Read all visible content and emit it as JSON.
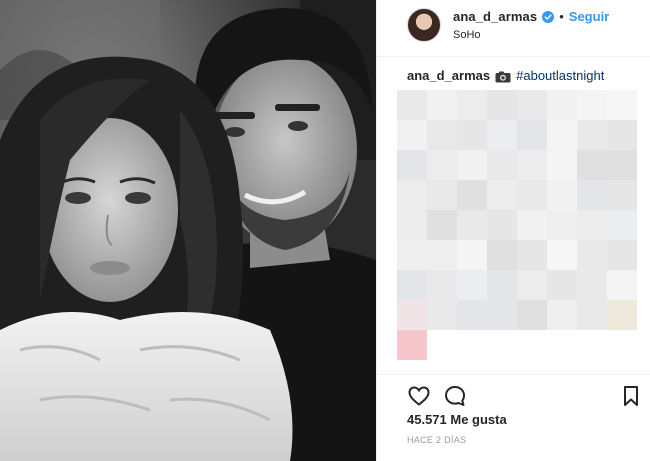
{
  "post": {
    "username": "ana_d_armas",
    "verified": true,
    "follow_label": "Seguir",
    "separator": "•",
    "location": "SoHo",
    "caption": {
      "user": "ana_d_armas",
      "emoji": "camera-icon",
      "hashtag": "#aboutlastnight"
    },
    "likes": "45.571 Me gusta",
    "time": "HACE 2 DÍAS"
  },
  "colors": {
    "link": "#3897f0",
    "hashtag": "#003569",
    "border": "#efefef",
    "muted": "#999999"
  },
  "icons": {
    "like": "heart-outline-icon",
    "comment": "comment-bubble-icon",
    "save": "bookmark-icon",
    "verified": "verified-badge-icon"
  }
}
